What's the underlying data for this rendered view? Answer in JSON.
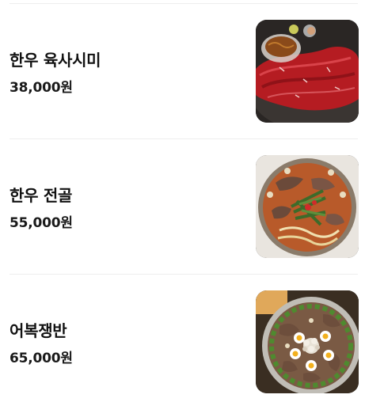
{
  "menu": {
    "items": [
      {
        "name": "한우 육사시미",
        "price": "38,000원",
        "image_icon": "beef-sashimi-photo"
      },
      {
        "name": "한우 전골",
        "price": "55,000원",
        "image_icon": "beef-hotpot-photo"
      },
      {
        "name": "어복쟁반",
        "price": "65,000원",
        "image_icon": "eobok-jaengban-photo"
      }
    ]
  },
  "colors": {
    "divider": "#eeeeee",
    "text": "#111111"
  }
}
